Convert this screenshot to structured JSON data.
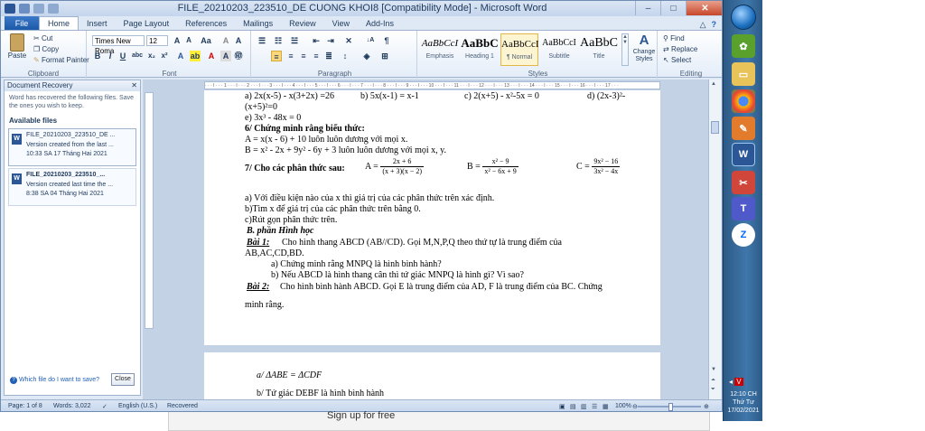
{
  "window": {
    "title": "FILE_20210203_223510_DE CUONG KHOI8 [Compatibility Mode] - Microsoft Word",
    "controls": [
      "–",
      "□",
      "✕"
    ]
  },
  "tabs": {
    "file": "File",
    "items": [
      "Home",
      "Insert",
      "Page Layout",
      "References",
      "Mailings",
      "Review",
      "View",
      "Add-Ins"
    ],
    "active": "Home"
  },
  "ribbon": {
    "clipboard": {
      "label": "Clipboard",
      "paste": "Paste",
      "cut": "Cut",
      "copy": "Copy",
      "format_painter": "Format Painter"
    },
    "font": {
      "label": "Font",
      "name": "Times New Roma",
      "size": "12"
    },
    "paragraph": {
      "label": "Paragraph"
    },
    "styles": {
      "label": "Styles",
      "items": [
        {
          "preview": "AaBbCcI",
          "name": "Emphasis"
        },
        {
          "preview": "AaBbC",
          "name": "Heading 1"
        },
        {
          "preview": "AaBbCcI",
          "name": "¶ Normal"
        },
        {
          "preview": "AaBbCcI",
          "name": "Subtitle"
        },
        {
          "preview": "AaBbC",
          "name": "Title"
        }
      ],
      "change_styles": "Change Styles"
    },
    "editing": {
      "label": "Editing",
      "find": "Find",
      "replace": "Replace",
      "select": "Select"
    }
  },
  "recovery": {
    "title": "Document Recovery",
    "message": "Word has recovered the following files. Save the ones you wish to keep.",
    "available": "Available files",
    "files": [
      {
        "name": "FILE_20210203_223510_DE ...",
        "line1": "Version created from the last ...",
        "line2": "10:33 SA 17 Tháng Hai 2021"
      },
      {
        "name": "FILE_20210203_223510_...",
        "line1": "Version created last time the ...",
        "line2": "8:38 SA 04 Tháng Hai 2021"
      }
    ],
    "which_file": "Which file do I want to save?",
    "close": "Close"
  },
  "document": {
    "page1": {
      "l1a": "a) 2x(x-5) - x(3+2x) =26",
      "l1b": "b) 5x(x-1) = x-1",
      "l1c": "c) 2(x+5) - x²-5x = 0",
      "l1d": "d) (2x-3)²-",
      "l2": "(x+5)²=0",
      "l3": "e) 3x³ - 48x = 0",
      "l4": "6/ Chứng minh rằng biểu thức:",
      "l5": "A = x(x - 6) + 10 luôn luôn dương với mọi x.",
      "l6": "B = x² - 2x + 9y² - 6y + 3 luôn luôn dương với mọi x, y.",
      "l7": "7/ Cho các phân thức sau:",
      "fracA_label": "A =",
      "fracA_num": "2x + 6",
      "fracA_den": "(x + 3)(x − 2)",
      "fracB_label": "B =",
      "fracB_num": "x² − 9",
      "fracB_den": "x² − 6x + 9",
      "fracC_label": "C =",
      "fracC_num": "9x² − 16",
      "fracC_den": "3x² − 4x",
      "l8": "a) Với điều kiện nào của x thì giá trị của các phân thức trên xác định.",
      "l9": "b)Tìm x để giá trị của các phân thức trên bằng 0.",
      "l10": "c)Rút gọn phân thức trên.",
      "l11": "B. phần Hình học",
      "l12_label": "Bài 1:",
      "l12": "Cho hình thang ABCD (AB//CD). Gọi M,N,P,Q theo thứ tự là trung điểm của",
      "l13": "AB,AC,CD,BD.",
      "l14": "a) Chứng minh rằng MNPQ là hình bình hành?",
      "l15": "b) Nếu ABCD là hình thang cân thì tứ giác MNPQ là hình gì? Vì sao?",
      "l16_label": "Bài 2:",
      "l16": "Cho hình bình hành ABCD. Gọi E là trung điểm của AD, F là trung điểm của BC. Chứng",
      "l17": "minh rằng."
    },
    "page2": {
      "l1": "a/ ΔABE = ΔCDF",
      "l2": "b/ Tứ giác DEBF là hình bình hành"
    }
  },
  "status": {
    "page": "Page: 1 of 8",
    "words": "Words: 3,022",
    "language": "English (U.S.)",
    "recovered": "Recovered",
    "zoom": "100%"
  },
  "below": {
    "signup": "Sign up for free"
  },
  "taskbar": {
    "clock_time": "12:10 CH",
    "clock_day": "Thứ Tư",
    "clock_date": "17/02/2021"
  }
}
